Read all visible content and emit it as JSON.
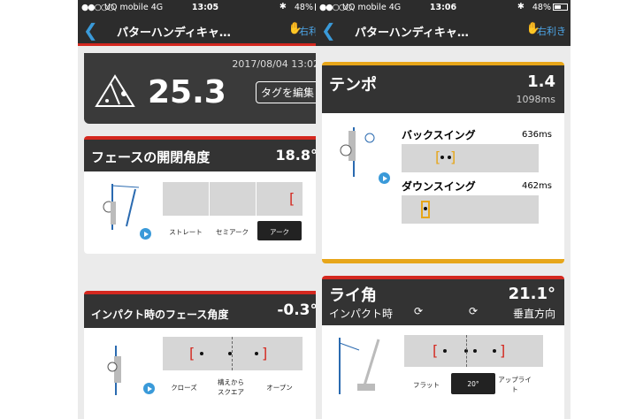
{
  "left": {
    "status": {
      "signal": "●●○○○",
      "carrier": "UQ mobile  4G",
      "time": "13:05",
      "bluetooth": "✱",
      "battery": "48%"
    },
    "nav": {
      "back_icon": "chevron-left",
      "title": "パターハンディキャ…",
      "hand_label": "右利き"
    },
    "summary": {
      "datetime": "2017/08/04 13:02",
      "score": "25.3",
      "edit_tag": "タグを編集"
    },
    "face_angle": {
      "title": "フェースの開閉角度",
      "value": "18.8°",
      "options": [
        "ストレート",
        "セミアーク",
        "アーク"
      ],
      "selected": "アーク"
    },
    "impact_face": {
      "title": "インパクト時のフェース角度",
      "value": "-0.3°",
      "options": [
        "クローズ",
        "構えから\nスクエア",
        "オープン"
      ]
    }
  },
  "right": {
    "status": {
      "signal": "●●○○○",
      "carrier": "UQ mobile  4G",
      "time": "13:06",
      "bluetooth": "✱",
      "battery": "48%"
    },
    "nav": {
      "back_icon": "chevron-left",
      "title": "パターハンディキャ…",
      "hand_label": "右利き"
    },
    "tempo": {
      "title": "テンポ",
      "value": "1.4",
      "ms": "1098ms",
      "back_label": "バックスイング",
      "back_ms": "636ms",
      "down_label": "ダウンスイング",
      "down_ms": "462ms"
    },
    "lie": {
      "title": "ライ角",
      "value": "21.1°",
      "sub_left": "インパクト時",
      "sub_right": "垂直方向",
      "options": [
        "フラット",
        "20°",
        "アップライト"
      ],
      "selected": "20°"
    }
  },
  "colors": {
    "accent_red": "#d4281f",
    "accent_yellow": "#e7a61a",
    "link_blue": "#3a9ad9",
    "header_dark": "#2c2c2c"
  }
}
